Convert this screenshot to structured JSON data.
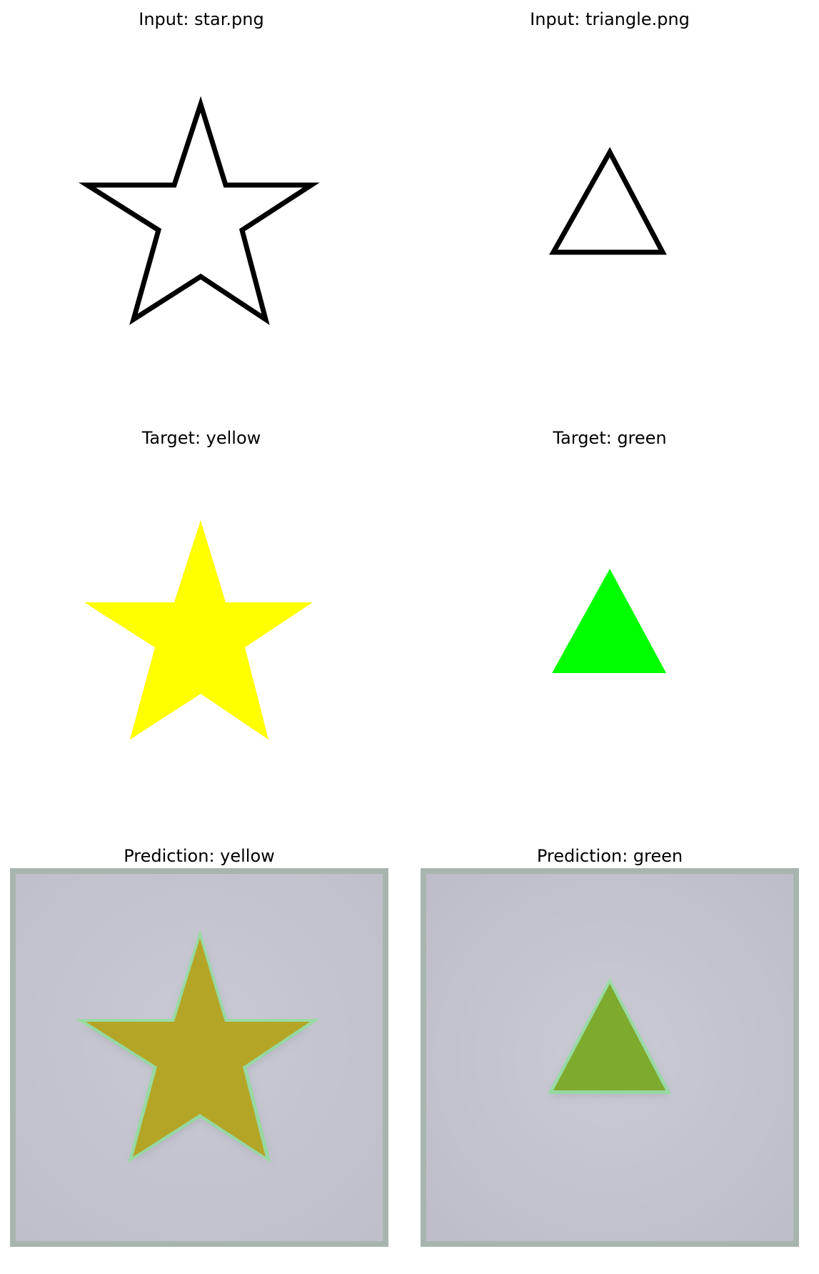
{
  "figure": {
    "panels": [
      {
        "title": "Input: star.png",
        "shape": "star",
        "style": "outline",
        "color": "#000000"
      },
      {
        "title": "Input: triangle.png",
        "shape": "triangle",
        "style": "outline",
        "color": "#000000"
      },
      {
        "title": "Target: yellow",
        "shape": "star",
        "style": "filled",
        "color": "#ffff00"
      },
      {
        "title": "Target: green",
        "shape": "triangle",
        "style": "filled",
        "color": "#00ff00"
      },
      {
        "title": "Prediction: yellow",
        "shape": "star",
        "style": "prediction",
        "color": "#b5a526",
        "background": "#c4c4cf"
      },
      {
        "title": "Prediction: green",
        "shape": "triangle",
        "style": "prediction",
        "color": "#7eaa2e",
        "background": "#c4c4cf"
      }
    ]
  }
}
